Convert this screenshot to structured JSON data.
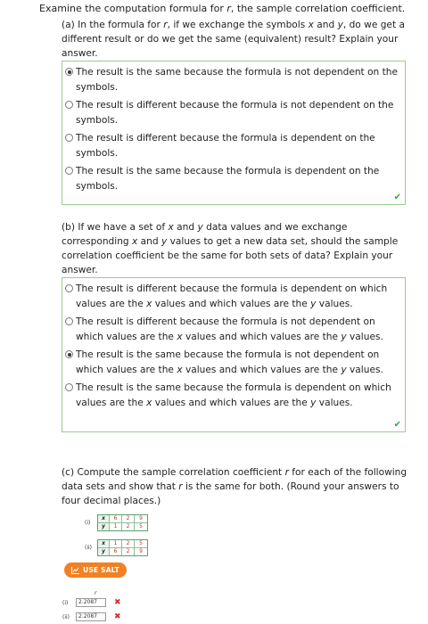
{
  "intro": {
    "pre": "Examine the computation formula for ",
    "var": "r",
    "post": ", the sample correlation coefficient."
  },
  "part_a": {
    "q_pre": "(a) In the formula for ",
    "q_r": "r",
    "q_mid1": ", if we exchange the symbols ",
    "q_x": "x",
    "q_and": " and ",
    "q_y": "y",
    "q_post": ", do we get a different result or do we get the same (equivalent) result? Explain your answer.",
    "options": [
      "The result is the same because the formula is not dependent on the symbols.",
      "The result is different because the formula is not dependent on the symbols.",
      "The result is different because the formula is dependent on the symbols.",
      "The result is the same because the formula is dependent on the symbols."
    ],
    "selected_index": 0,
    "check": "✔"
  },
  "part_b": {
    "q_pre": "(b) If we have a set of ",
    "q_x": "x",
    "q_and": " and ",
    "q_y": "y",
    "q_mid": " data values and we exchange corresponding ",
    "q_x2": "x",
    "q_and2": " and ",
    "q_y2": "y",
    "q_post": " values to get a new data set, should the sample correlation coefficient be the same for both sets of data? Explain your answer.",
    "options": [
      {
        "a": "The result is different because the formula is dependent on which values are the ",
        "b": " values and which values are the ",
        "c": " values."
      },
      {
        "a": "The result is different because the formula is not dependent on which values are the ",
        "b": " values and which values are the ",
        "c": " values."
      },
      {
        "a": "The result is the same because the formula is not dependent on which values are the ",
        "b": " values and which values are the ",
        "c": " values."
      },
      {
        "a": "The result is the same because the formula is dependent on which values are the ",
        "b": " values and which values are the ",
        "c": " values."
      }
    ],
    "selected_index": 2,
    "check": "✔"
  },
  "part_c": {
    "q_pre": "(c) Compute the sample correlation coefficient ",
    "q_r": "r",
    "q_mid": " for each of the following data sets and show that ",
    "q_r2": "r",
    "q_post": " is the same for both. (Round your answers to four decimal places.)",
    "tables": [
      {
        "label": "(i)",
        "x_head": "x",
        "y_head": "y",
        "x": [
          "6",
          "2",
          "9"
        ],
        "y": [
          "1",
          "2",
          "5"
        ]
      },
      {
        "label": "(ii)",
        "x_head": "x",
        "y_head": "y",
        "x": [
          "1",
          "2",
          "5"
        ],
        "y": [
          "6",
          "2",
          "9"
        ]
      }
    ],
    "salt_label": "USE SALT",
    "r_header": "r",
    "answers": [
      {
        "label": "(i)",
        "value": "2.2087",
        "mark": "✖"
      },
      {
        "label": "(ii)",
        "value": "2.2087",
        "mark": "✖"
      }
    ]
  },
  "colors": {
    "accent": "#f08124",
    "box_border": "#9ccc8e",
    "correct": "#3aa53a",
    "incorrect": "#d0312d"
  }
}
